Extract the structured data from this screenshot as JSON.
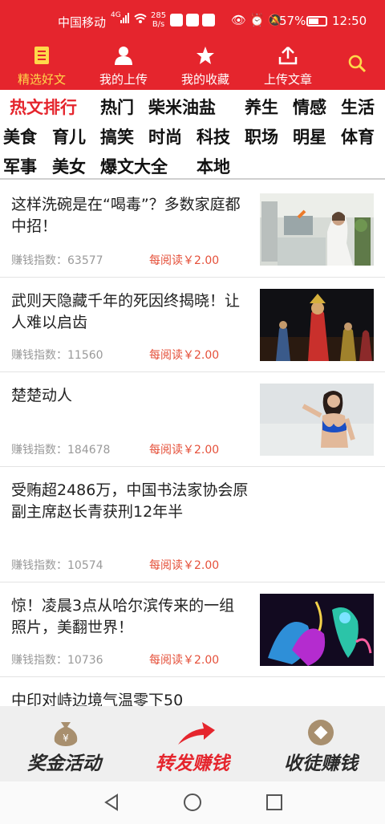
{
  "status_bar": {
    "carrier": "中国移动",
    "signal": "⁴ᴳ",
    "net_speed_value": "285",
    "net_speed_unit": "B/s",
    "battery": "57%",
    "time": "12:50"
  },
  "top_nav": {
    "items": [
      {
        "label": "精选好文",
        "icon": "document-icon"
      },
      {
        "label": "我的上传",
        "icon": "user-icon"
      },
      {
        "label": "我的收藏",
        "icon": "star-icon"
      },
      {
        "label": "上传文章",
        "icon": "upload-icon"
      }
    ],
    "search_icon": "search-icon",
    "accent": "#e5252d",
    "active_color": "#ffd84a"
  },
  "categories": [
    "热文排行",
    "热门",
    "柴米油盐",
    "养生",
    "情感",
    "生活",
    "美食",
    "育儿",
    "搞笑",
    "时尚",
    "科技",
    "职场",
    "明星",
    "体育",
    "军事",
    "美女",
    "爆文大全",
    "本地"
  ],
  "feed": {
    "index_label": "赚钱指数：",
    "items": [
      {
        "title": "这样洗碗是在“喝毒”？多数家庭都中招！",
        "index": "63577",
        "reward": "每阅读￥2.00",
        "thumb": "kitchen"
      },
      {
        "title": "武则天隐藏千年的死因终揭晓！让人难以启齿",
        "index": "11560",
        "reward": "每阅读￥2.00",
        "thumb": "stage"
      },
      {
        "title": "楚楚动人",
        "index": "184678",
        "reward": "每阅读￥2.00",
        "thumb": "beach"
      },
      {
        "title": "受贿超2486万，中国书法家协会原副主席赵长青获刑12年半",
        "index": "10574",
        "reward": "每阅读￥2.00",
        "thumb": ""
      },
      {
        "title": "惊！凌晨3点从哈尔滨传来的一组照片，美翻世界！",
        "index": "10736",
        "reward": "每阅读￥2.00",
        "thumb": "ice"
      },
      {
        "title": "中印对峙边境气温零下50",
        "index": "",
        "reward": "",
        "thumb": ""
      }
    ]
  },
  "actions": [
    {
      "label": "奖金活动",
      "icon": "money-bag-icon"
    },
    {
      "label": "转发赚钱",
      "icon": "share-arrow-icon"
    },
    {
      "label": "收徒赚钱",
      "icon": "coin-icon"
    }
  ]
}
